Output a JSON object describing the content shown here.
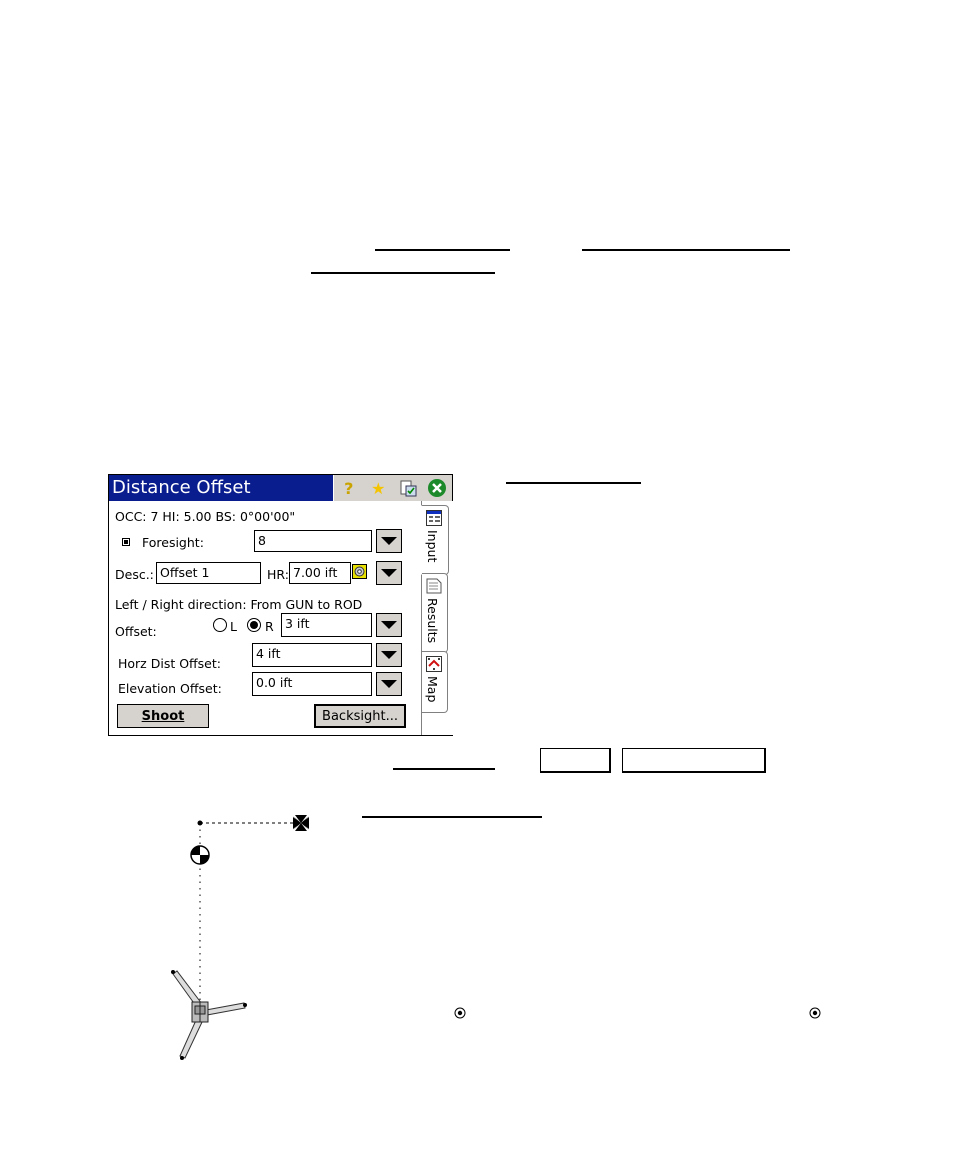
{
  "dialog": {
    "title": "Distance Offset",
    "toolbar_icons": [
      "help-icon",
      "favorite-star-icon",
      "clipboard-check-icon",
      "close-icon"
    ],
    "status_line": "OCC: 7  HI: 5.00  BS: 0°00'00\"",
    "foresight": {
      "label": "Foresight:",
      "value": "8"
    },
    "description": {
      "label": "Desc.:",
      "value": "Offset 1"
    },
    "hr": {
      "label": "HR:",
      "value": "7.00 ift"
    },
    "direction_note": "Left / Right direction:  From GUN to ROD",
    "offset": {
      "label": "Offset:",
      "radio_left": "L",
      "radio_right": "R",
      "selected": "R",
      "value": "3 ift"
    },
    "horz_dist_offset": {
      "label": "Horz Dist Offset:",
      "value": "4 ift"
    },
    "elevation_offset": {
      "label": "Elevation Offset:",
      "value": "0.0 ift"
    },
    "shoot_button": "Shoot",
    "backsight_button": "Backsight...",
    "tabs": [
      {
        "label": "Input",
        "icon": "input-form-icon",
        "active": true
      },
      {
        "label": "Results",
        "icon": "results-sheet-icon",
        "active": false
      },
      {
        "label": "Map",
        "icon": "map-icon",
        "active": false
      }
    ]
  },
  "diagram": {
    "symbols": [
      "occupied-point-icon",
      "target-point-icon",
      "offset-point-icon",
      "instrument-tripod-icon",
      "control-point-icon"
    ]
  }
}
